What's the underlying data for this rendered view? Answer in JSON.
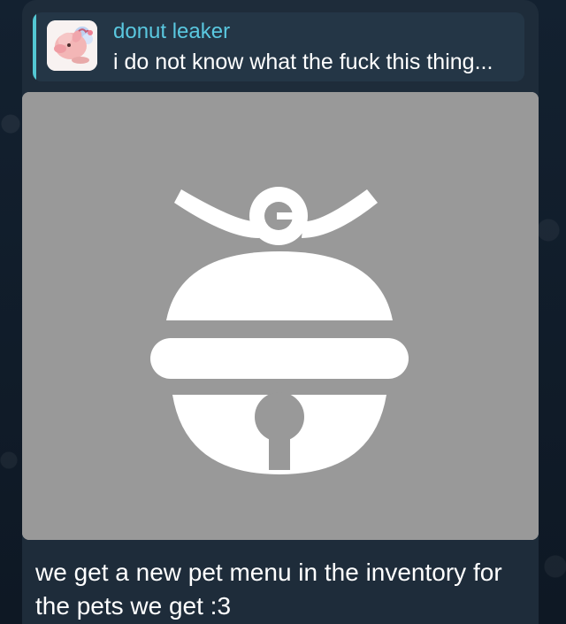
{
  "message": {
    "reply": {
      "author": "donut leaker",
      "text": "i do not know what the fuck this thing..."
    },
    "image_icon": "bell-icon",
    "text": "we get a new pet menu in the inventory for the pets we get :3"
  },
  "colors": {
    "background": "#0f1a26",
    "bubble": "#1e2c3a",
    "reply_background": "#243646",
    "reply_bar": "#53c7d3",
    "author": "#5ac8e0",
    "text": "#ffffff",
    "media_background": "#999999"
  }
}
